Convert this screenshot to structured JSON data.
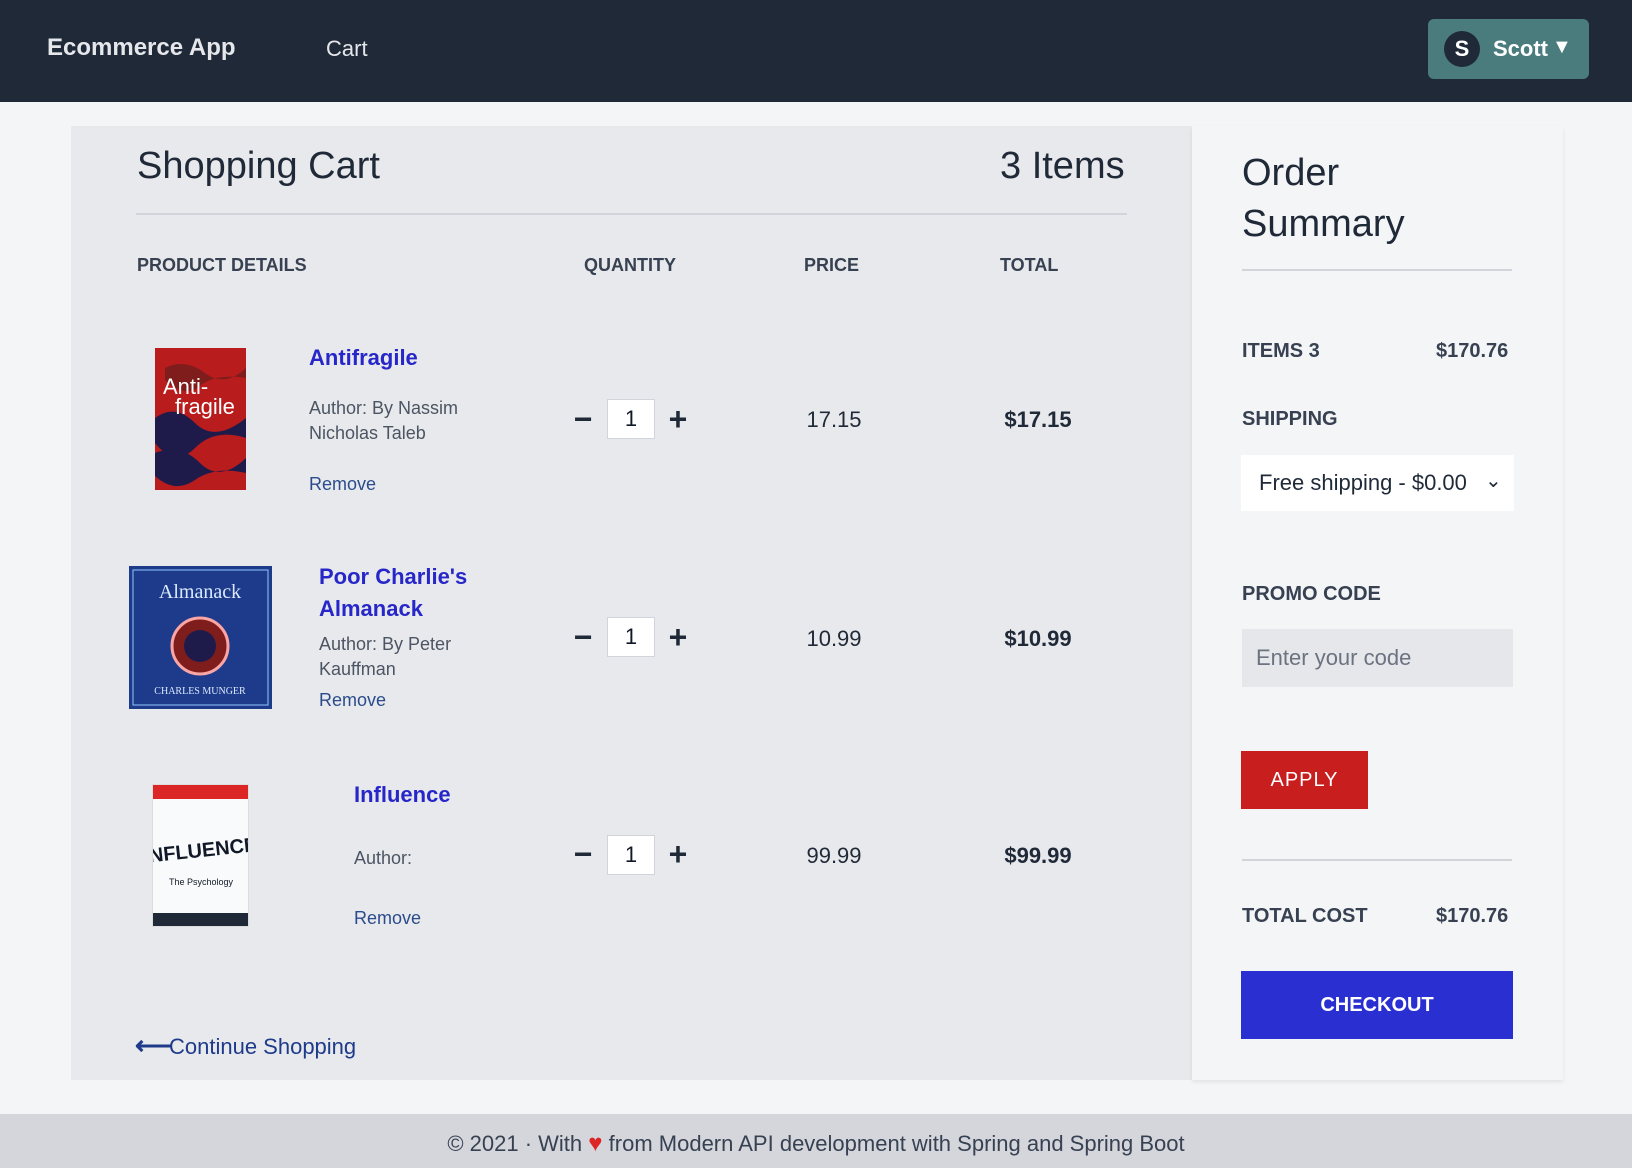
{
  "nav": {
    "brand": "Ecommerce App",
    "cart_link": "Cart",
    "user": {
      "initial": "S",
      "name": "Scott",
      "caret": "▼"
    }
  },
  "cart": {
    "title": "Shopping Cart",
    "count_label": "3 Items",
    "columns": {
      "product": "PRODUCT DETAILS",
      "quantity": "QUANTITY",
      "price": "PRICE",
      "total": "TOTAL"
    },
    "items": [
      {
        "name": "Antifragile",
        "author": "Author: By Nassim Nicholas Taleb",
        "remove": "Remove",
        "qty": "1",
        "price": "17.15",
        "total": "$17.15",
        "cover_text": "Anti-fragile"
      },
      {
        "name": "Poor Charlie's Almanack",
        "author": "Author: By Peter Kauffman",
        "remove": "Remove",
        "qty": "1",
        "price": "10.99",
        "total": "$10.99",
        "cover_text": "Almanack"
      },
      {
        "name": "Influence",
        "author": "Author:",
        "remove": "Remove",
        "qty": "1",
        "price": "99.99",
        "total": "$99.99",
        "cover_text": "INFLUENCE"
      }
    ],
    "qty_minus": "−",
    "qty_plus": "+",
    "continue_label": "Continue Shopping"
  },
  "summary": {
    "title": "Order Summary",
    "items_label": "ITEMS 3",
    "items_value": "$170.76",
    "shipping_label": "SHIPPING",
    "shipping_selected": "Free shipping - $0.00",
    "promo_label": "PROMO CODE",
    "promo_placeholder": "Enter your code",
    "apply_label": "APPLY",
    "total_label": "TOTAL COST",
    "total_value": "$170.76",
    "checkout_label": "CHECKOUT"
  },
  "footer": {
    "prefix": "© 2021 · With",
    "suffix": "from Modern API development with Spring and Spring Boot"
  },
  "colors": {
    "nav_bg": "#1f2937",
    "accent_blue": "#2a2fd2",
    "apply_red": "#c81e1e",
    "user_btn": "#4a7c7e"
  }
}
